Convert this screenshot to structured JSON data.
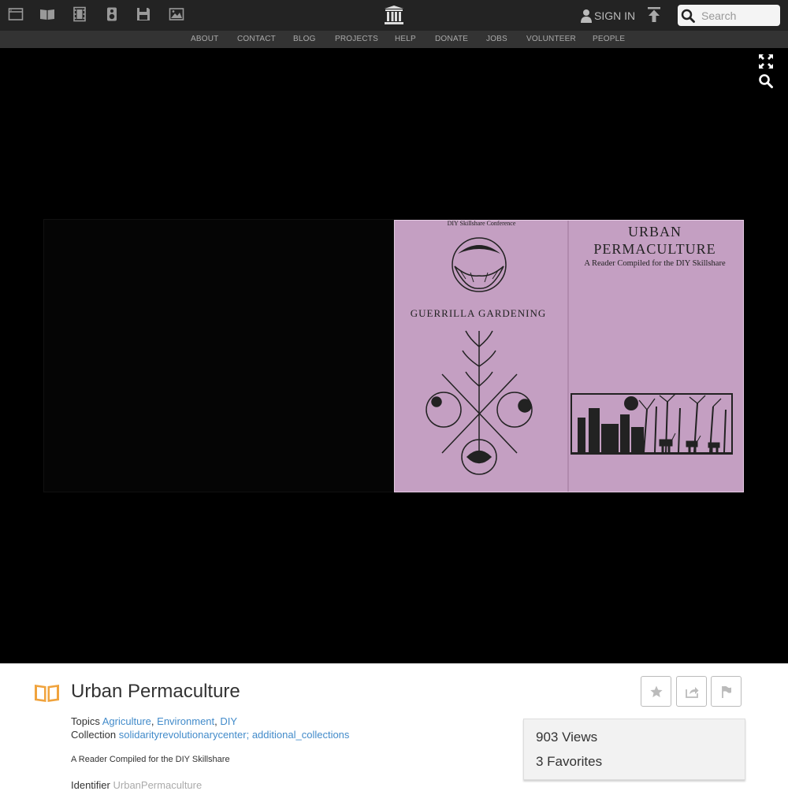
{
  "topbar": {
    "media_icons": [
      "web-icon",
      "texts-icon",
      "video-icon",
      "audio-icon",
      "software-icon",
      "images-icon"
    ],
    "logo_icon": "archive-logo-icon",
    "signin_label": "SIGN IN",
    "upload_icon": "upload-icon",
    "search": {
      "placeholder": "Search",
      "value": ""
    }
  },
  "nav": {
    "items": [
      "ABOUT",
      "CONTACT",
      "BLOG",
      "PROJECTS",
      "HELP",
      "DONATE",
      "JOBS",
      "VOLUNTEER",
      "PEOPLE"
    ]
  },
  "viewer": {
    "controls": [
      "fullscreen-icon",
      "zoom-search-icon"
    ],
    "cover": {
      "header_text": "DIY Skillshare Conference",
      "back_heading": "GUERRILLA GARDENING",
      "front_title_1": "URBAN",
      "front_title_2": "PERMACULTURE",
      "front_subtitle": "A Reader Compiled for the DIY Skillshare"
    }
  },
  "details": {
    "title": "Urban Permaculture",
    "topics_label": "Topics",
    "topics": [
      "Agriculture",
      "Environment",
      "DIY"
    ],
    "collection_label": "Collection",
    "collections": [
      "solidarityrevolutionarycenter",
      "additional_collections"
    ],
    "description": "A Reader Compiled for the DIY Skillshare",
    "identifier_label": "Identifier",
    "identifier_value": "UrbanPermaculture",
    "actions": [
      "favorite-icon",
      "share-icon",
      "flag-icon"
    ],
    "views": "903 Views",
    "favorites": "3 Favorites"
  },
  "colors": {
    "topbar_bg": "#232323",
    "nav_bg": "#333333",
    "viewer_bg": "#000000",
    "link": "#428bca",
    "book_icon": "#f0a33d",
    "cover_tint": "#c9a3c6"
  }
}
